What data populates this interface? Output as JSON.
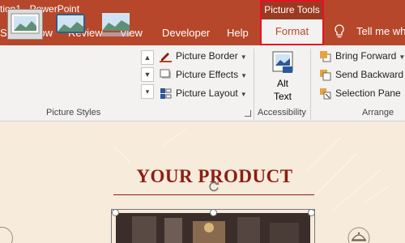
{
  "titlebar": {
    "doc_title": "tion1  -  PowerPoint",
    "context_tab_group": "Picture Tools"
  },
  "tabs": [
    {
      "label": "Slide Show"
    },
    {
      "label": "Review"
    },
    {
      "label": "View"
    },
    {
      "label": "Developer"
    },
    {
      "label": "Help"
    }
  ],
  "active_tab": {
    "label": "Format"
  },
  "tell_me": {
    "label": "Tell me wha"
  },
  "ribbon": {
    "picture_styles": {
      "group_label": "Picture Styles",
      "picture_border": "Picture Border",
      "picture_effects": "Picture Effects",
      "picture_layout": "Picture Layout"
    },
    "accessibility": {
      "group_label": "Accessibility",
      "alt_text_line1": "Alt",
      "alt_text_line2": "Text"
    },
    "arrange": {
      "group_label": "Arrange",
      "bring_forward": "Bring Forward",
      "send_backward": "Send Backward",
      "selection_pane": "Selection Pane"
    }
  },
  "slide": {
    "title": "YOUR PRODUCT"
  },
  "colors": {
    "accent": "#b7472a",
    "title_red": "#8b1e13",
    "slide_bg": "#f7ebdb",
    "selection_outline": "#e81123"
  }
}
